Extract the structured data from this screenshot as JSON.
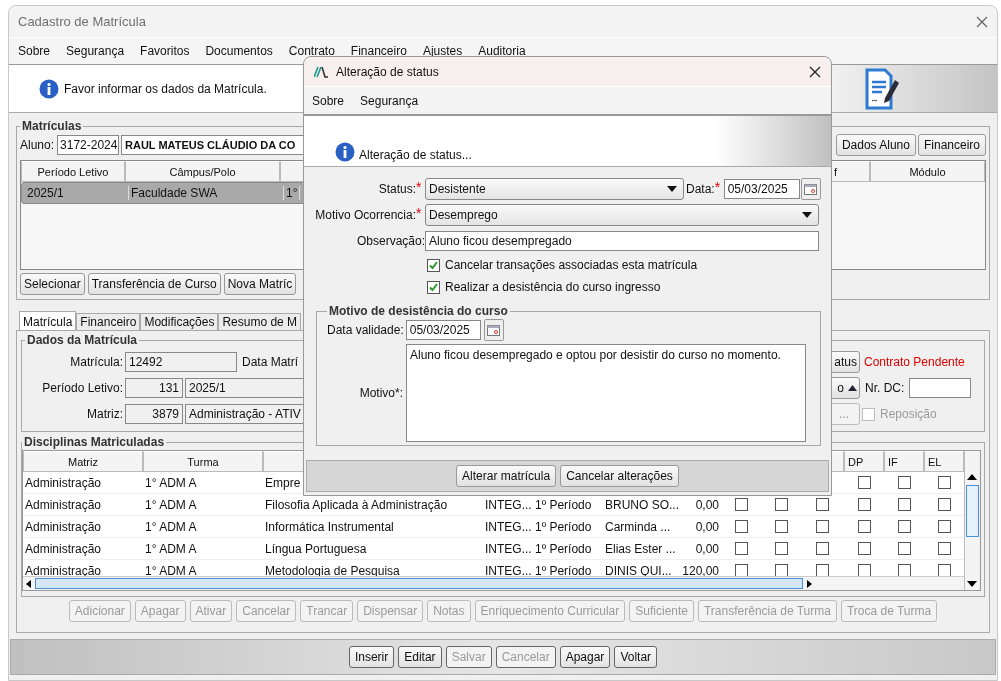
{
  "window": {
    "title": "Cadastro de Matrícula"
  },
  "menu": [
    "Sobre",
    "Segurança",
    "Favoritos",
    "Documentos",
    "Contrato",
    "Financeiro",
    "Ajustes",
    "Auditoria"
  ],
  "info_message": "Favor informar os dados da Matrícula.",
  "matriculas": {
    "title": "Matrículas",
    "aluno_label": "Aluno:",
    "aluno_code": "3172-2024",
    "aluno_name": "RAUL MATEUS CLÁUDIO DA CO",
    "buttons": [
      "Dados Aluno",
      "Financeiro"
    ],
    "columns": [
      "Período Letivo",
      "Câmpus/Polo",
      "f",
      "Módulo"
    ],
    "rows": [
      {
        "cells": [
          "2025/1",
          "Faculdade SWA",
          "1°"
        ],
        "selected": true
      }
    ],
    "actions": [
      "Selecionar",
      "Transferência de Curso",
      "Nova Matríc"
    ]
  },
  "tabs": [
    {
      "label": "Matrícula",
      "selected": true
    },
    {
      "label": "Financeiro",
      "selected": false
    },
    {
      "label": "Modificações",
      "selected": false
    },
    {
      "label": "Resumo de M",
      "selected": false
    }
  ],
  "dados": {
    "title": "Dados da Matrícula",
    "matricula_label": "Matrícula:",
    "matricula": "12492",
    "data_label": "Data Matrí",
    "periodo_label": "Período Letivo:",
    "periodo_code": "131",
    "periodo": "2025/1",
    "matriz_label": "Matriz:",
    "matriz_code": "3879",
    "matriz": "Administração - ATIV",
    "status_button": "atus",
    "contract_status": "Contrato Pendente",
    "sort_button": "o",
    "nr_dc_label": "Nr. DC:",
    "more_button": {
      "label": "...",
      "disabled": true
    },
    "reposicao": {
      "label": "Reposição",
      "checked": false,
      "disabled": true
    }
  },
  "disciplinas": {
    "title": "Disciplinas Matriculadas",
    "columns": [
      "Matriz",
      "Turma"
    ],
    "right_columns": [
      "DP",
      "IF",
      "EL"
    ],
    "rows": [
      {
        "cells": [
          "Administração",
          "1° ADM A",
          "Empre"
        ],
        "checks": [
          false,
          false,
          false
        ]
      },
      {
        "cells": [
          "Administração",
          "1° ADM A",
          "Filosofia Aplicada à Administração",
          "INTEG...",
          "1º Período",
          "BRUNO SO...",
          "0,00"
        ],
        "checks": [
          false,
          false,
          false,
          false,
          false,
          false
        ]
      },
      {
        "cells": [
          "Administração",
          "1° ADM A",
          "Informática Instrumental",
          "INTEG...",
          "1º Período",
          "Carminda ...",
          "0,00"
        ],
        "checks": [
          false,
          false,
          false,
          false,
          false,
          false
        ]
      },
      {
        "cells": [
          "Administração",
          "1° ADM A",
          "Língua Portuguesa",
          "INTEG...",
          "1º Período",
          "Elias Ester ...",
          "0,00"
        ],
        "checks": [
          false,
          false,
          false,
          false,
          false,
          false
        ]
      },
      {
        "cells": [
          "Administração",
          "1° ADM A",
          "Metodologia de Pesquisa",
          "INTEG...",
          "1º Período",
          "DINIS QUI...",
          "120,00"
        ],
        "checks": [
          false,
          false,
          false,
          false,
          false,
          false
        ]
      }
    ]
  },
  "actions": [
    {
      "label": "Adicionar",
      "disabled": true
    },
    {
      "label": "Apagar",
      "disabled": true
    },
    {
      "label": "Ativar",
      "disabled": true
    },
    {
      "label": "Cancelar",
      "disabled": true
    },
    {
      "label": "Trancar",
      "disabled": true
    },
    {
      "label": "Dispensar",
      "disabled": true
    },
    {
      "label": "Notas",
      "disabled": true
    },
    {
      "label": "Enriquecimento Curricular",
      "disabled": true
    },
    {
      "label": "Suficiente",
      "disabled": true
    },
    {
      "label": "Transferência de Turma",
      "disabled": true
    },
    {
      "label": "Troca de Turma",
      "disabled": true
    }
  ],
  "footer_buttons": [
    {
      "label": "Inserir",
      "disabled": false
    },
    {
      "label": "Editar",
      "disabled": false
    },
    {
      "label": "Salvar",
      "disabled": true
    },
    {
      "label": "Cancelar",
      "disabled": true
    },
    {
      "label": "Apagar",
      "disabled": false
    },
    {
      "label": "Voltar",
      "disabled": false
    }
  ],
  "dialog": {
    "title": "Alteração de status",
    "menu": [
      "Sobre",
      "Segurança"
    ],
    "header": "Alteração de status...",
    "status": {
      "label": "Status:",
      "required_mark": "*",
      "value": "Desistente"
    },
    "data": {
      "label": "Data:",
      "required_mark": "*",
      "value": "05/03/2025"
    },
    "motivo_ocorrencia": {
      "label": "Motivo Ocorrencia:",
      "required_mark": "*",
      "value": "Desemprego"
    },
    "observacao": {
      "label": "Observação:",
      "value": "Aluno ficou desempregado"
    },
    "options": [
      {
        "label": "Cancelar transações associadas esta matrícula",
        "checked": true
      },
      {
        "label": "Realizar a desistência do curso ingresso",
        "checked": true
      }
    ],
    "group": {
      "title": "Motivo de desistência do curso",
      "data_validade_label": "Data validade:",
      "data_validade": "05/03/2025",
      "motivo_label": "Motivo*:",
      "motivo": "Aluno ficou desempregado e optou por desistir do curso no momento."
    },
    "buttons": [
      "Alterar matrícula",
      "Cancelar alterações"
    ]
  }
}
